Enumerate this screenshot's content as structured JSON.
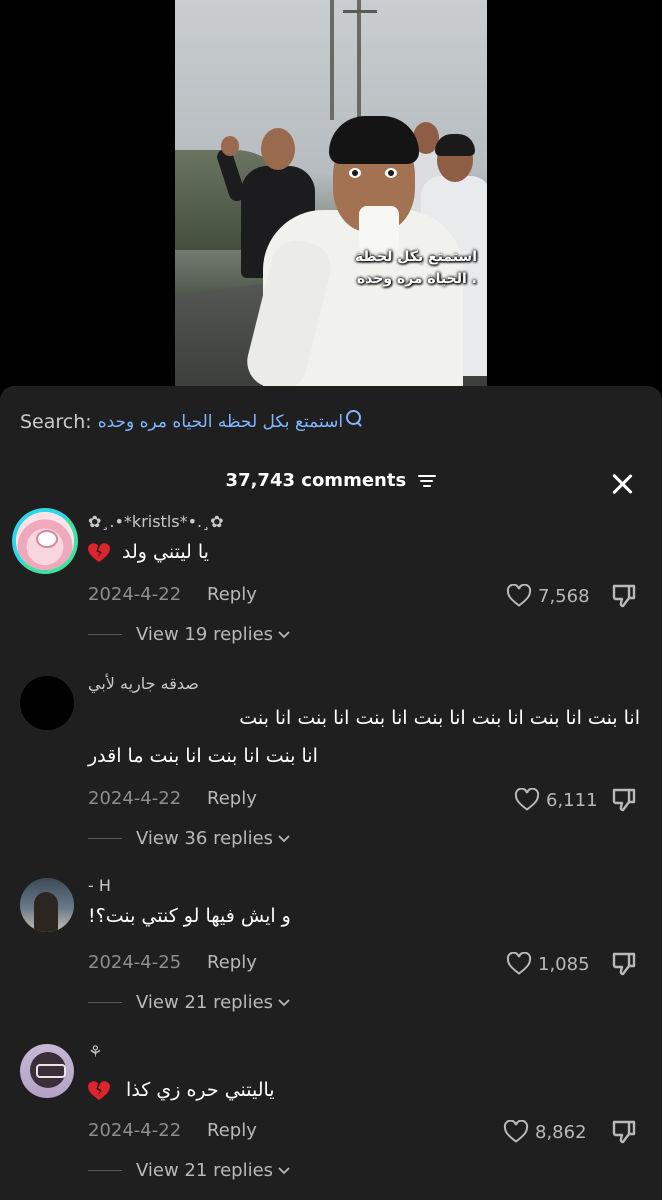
{
  "video": {
    "caption_line1": "استمتع بكل لحظة",
    "caption_line2": "الحياة مره وحده ."
  },
  "search": {
    "label": "Search:",
    "query": "استمتع بكل لحظه الحياه مره وحده"
  },
  "header": {
    "comment_count": "37,743 comments"
  },
  "comments": [
    {
      "username": "✿¸.•*kristls*•.¸✿",
      "text": "يا ليتني ولد",
      "has_broken_heart": true,
      "date": "2024-4-22",
      "reply_label": "Reply",
      "likes": "7,568",
      "view_replies": "View 19 replies"
    },
    {
      "username": "صدقه جاريه لأبي",
      "text_line1": "انا بنت انا بنت انا بنت انا بنت انا بنت انا بنت انا بنت",
      "text_line2": "انا بنت انا بنت انا بنت ما اقدر",
      "date": "2024-4-22",
      "reply_label": "Reply",
      "likes": "6,111",
      "view_replies": "View 36 replies"
    },
    {
      "username": "- H",
      "text": "و ايش فيها لو كنتي بنت؟!",
      "date": "2024-4-25",
      "reply_label": "Reply",
      "likes": "1,085",
      "view_replies": "View 21 replies"
    },
    {
      "username": "⚘",
      "text": "ياليتني حره زي كذا",
      "has_broken_heart": true,
      "date": "2024-4-22",
      "reply_label": "Reply",
      "likes": "8,862",
      "view_replies": "View 21 replies"
    }
  ],
  "colors": {
    "sheet_bg": "#1f1f1f",
    "search_accent": "#7fb6ff",
    "broken_heart": "#e0242c"
  }
}
